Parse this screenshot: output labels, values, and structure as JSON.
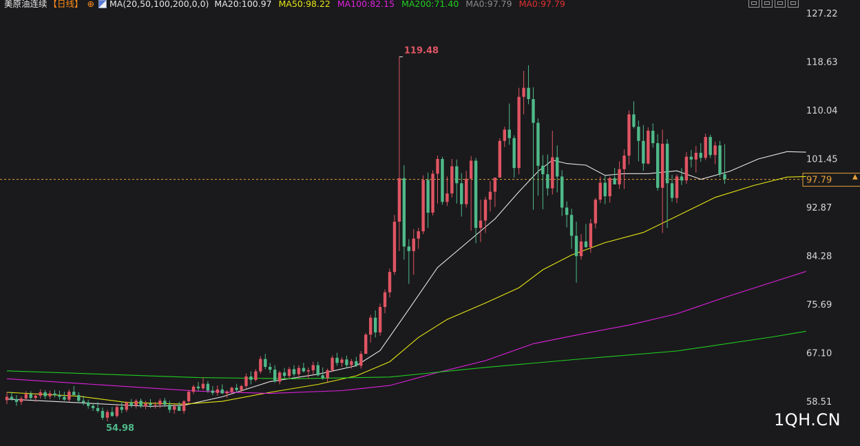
{
  "header": {
    "instrument": "美原油连续",
    "period": "【日线】",
    "settings_glyph": "⊕",
    "indicator_params": "MA(20,50,100,200,0,0)",
    "ma_values": [
      {
        "label": "MA20:100.97",
        "color": "#e8e8e8"
      },
      {
        "label": "MA50:98.22",
        "color": "#e6e614"
      },
      {
        "label": "MA100:82.15",
        "color": "#e020e0"
      },
      {
        "label": "MA200:71.40",
        "color": "#20d020"
      },
      {
        "label": "MA0:97.79",
        "color": "#8a8a8a"
      },
      {
        "label": "MA0:97.79",
        "color": "#e03030"
      }
    ]
  },
  "toolbar": {
    "icons": [
      "expand-icon",
      "window-icon",
      "layout-icon",
      "settings-panel-icon"
    ]
  },
  "watermark": "1QH.CN",
  "colors": {
    "up": "#e05563",
    "down": "#4fb98a",
    "grid": "#3a3a3a",
    "current_line": "#e8a23a",
    "background": "#1a1a1c"
  },
  "chart_data": {
    "type": "candlestick",
    "title": "美原油连续【日线】",
    "y_axis_ticks": [
      "127.22",
      "118.63",
      "110.04",
      "101.45",
      "92.87",
      "84.28",
      "75.69",
      "67.10",
      "58.51"
    ],
    "ylim": [
      53.5,
      128.5
    ],
    "current_price_label": "97.79",
    "current_price": 97.79,
    "annotations": {
      "max_label": "119.48",
      "max_value": 119.48,
      "max_index": 82,
      "min_label": "54.98",
      "min_value": 54.98,
      "min_index": 21
    },
    "ohlc": [
      [
        58.7,
        60.1,
        58.0,
        59.3
      ],
      [
        59.3,
        60.2,
        58.6,
        58.9
      ],
      [
        58.9,
        59.6,
        57.7,
        58.4
      ],
      [
        58.4,
        59.4,
        57.9,
        59.0
      ],
      [
        59.0,
        60.3,
        58.6,
        59.8
      ],
      [
        59.8,
        60.3,
        58.8,
        59.1
      ],
      [
        59.1,
        59.9,
        58.4,
        59.5
      ],
      [
        59.5,
        60.6,
        59.0,
        60.1
      ],
      [
        60.1,
        60.5,
        58.9,
        59.4
      ],
      [
        59.4,
        60.4,
        58.9,
        59.9
      ],
      [
        59.9,
        60.5,
        59.2,
        59.6
      ],
      [
        59.6,
        60.4,
        58.8,
        59.3
      ],
      [
        59.3,
        60.2,
        58.6,
        58.8
      ],
      [
        58.8,
        60.6,
        58.4,
        60.2
      ],
      [
        60.2,
        61.2,
        59.8,
        59.6
      ],
      [
        59.6,
        60.1,
        58.2,
        58.6
      ],
      [
        58.6,
        59.5,
        57.8,
        58.3
      ],
      [
        58.3,
        58.8,
        57.2,
        57.7
      ],
      [
        57.7,
        58.1,
        56.8,
        57.3
      ],
      [
        57.3,
        58.4,
        56.5,
        56.8
      ],
      [
        56.8,
        57.4,
        55.2,
        55.6
      ],
      [
        55.6,
        57.0,
        54.98,
        56.6
      ],
      [
        56.6,
        57.5,
        55.8,
        55.9
      ],
      [
        55.9,
        57.9,
        55.6,
        57.5
      ],
      [
        57.5,
        58.5,
        56.4,
        57.0
      ],
      [
        57.0,
        58.5,
        56.6,
        58.3
      ],
      [
        58.3,
        58.9,
        57.4,
        57.8
      ],
      [
        57.8,
        58.9,
        57.2,
        58.6
      ],
      [
        58.6,
        59.0,
        57.3,
        57.6
      ],
      [
        57.6,
        58.6,
        57.1,
        58.1
      ],
      [
        58.1,
        58.9,
        57.3,
        57.8
      ],
      [
        57.8,
        58.4,
        57.2,
        57.9
      ],
      [
        57.9,
        59.0,
        57.3,
        58.6
      ],
      [
        58.6,
        59.1,
        57.5,
        57.9
      ],
      [
        57.9,
        58.6,
        56.5,
        57.0
      ],
      [
        57.0,
        58.0,
        56.3,
        57.6
      ],
      [
        57.6,
        58.4,
        56.8,
        56.8
      ],
      [
        56.8,
        58.7,
        56.3,
        58.5
      ],
      [
        58.5,
        60.5,
        58.1,
        60.2
      ],
      [
        60.2,
        61.4,
        59.8,
        61.1
      ],
      [
        61.1,
        61.9,
        60.3,
        60.8
      ],
      [
        60.8,
        62.7,
        60.5,
        61.6
      ],
      [
        61.6,
        62.1,
        60.0,
        60.4
      ],
      [
        60.4,
        61.2,
        59.6,
        60.0
      ],
      [
        60.0,
        61.3,
        59.5,
        60.6
      ],
      [
        60.6,
        61.5,
        59.8,
        59.9
      ],
      [
        59.9,
        60.5,
        59.1,
        60.2
      ],
      [
        60.2,
        61.1,
        59.7,
        60.9
      ],
      [
        60.9,
        61.6,
        60.1,
        60.5
      ],
      [
        60.5,
        61.4,
        60.0,
        61.2
      ],
      [
        61.2,
        63.4,
        60.8,
        62.9
      ],
      [
        62.9,
        63.8,
        61.5,
        62.3
      ],
      [
        62.3,
        64.2,
        62.0,
        63.8
      ],
      [
        63.8,
        66.5,
        63.4,
        66.0
      ],
      [
        66.0,
        66.9,
        64.2,
        64.6
      ],
      [
        64.6,
        65.3,
        63.5,
        64.1
      ],
      [
        64.1,
        64.9,
        61.8,
        62.0
      ],
      [
        62.0,
        63.9,
        61.5,
        63.6
      ],
      [
        63.6,
        64.4,
        62.6,
        63.0
      ],
      [
        63.0,
        64.6,
        62.5,
        64.2
      ],
      [
        64.2,
        64.9,
        62.9,
        63.3
      ],
      [
        63.3,
        64.9,
        62.6,
        64.4
      ],
      [
        64.4,
        65.3,
        63.6,
        63.8
      ],
      [
        63.8,
        64.5,
        62.5,
        64.0
      ],
      [
        64.0,
        65.5,
        63.3,
        64.9
      ],
      [
        64.9,
        65.5,
        62.9,
        63.1
      ],
      [
        63.1,
        64.5,
        62.3,
        62.6
      ],
      [
        62.6,
        64.3,
        61.9,
        64.0
      ],
      [
        64.0,
        66.6,
        63.7,
        66.2
      ],
      [
        66.2,
        67.1,
        64.8,
        65.3
      ],
      [
        65.3,
        66.3,
        64.6,
        65.9
      ],
      [
        65.9,
        66.6,
        64.4,
        64.9
      ],
      [
        64.9,
        66.0,
        64.3,
        65.6
      ],
      [
        65.6,
        66.4,
        64.6,
        64.8
      ],
      [
        64.8,
        67.4,
        64.3,
        66.9
      ],
      [
        66.9,
        70.6,
        68.5,
        70.3
      ],
      [
        70.3,
        73.8,
        68.9,
        73.3
      ],
      [
        73.3,
        74.6,
        69.8,
        70.7
      ],
      [
        70.7,
        75.8,
        70.1,
        75.2
      ],
      [
        75.2,
        78.3,
        74.1,
        77.8
      ],
      [
        77.8,
        82.0,
        76.9,
        81.4
      ],
      [
        81.4,
        91.5,
        80.9,
        90.3
      ],
      [
        90.3,
        119.48,
        85.1,
        98.0
      ],
      [
        98.0,
        100.3,
        83.6,
        85.9
      ],
      [
        85.9,
        87.2,
        79.3,
        85.1
      ],
      [
        85.1,
        89.0,
        80.9,
        87.3
      ],
      [
        87.3,
        89.2,
        85.5,
        88.6
      ],
      [
        88.6,
        98.5,
        88.1,
        97.7
      ],
      [
        97.7,
        99.0,
        89.2,
        91.9
      ],
      [
        91.9,
        99.4,
        91.4,
        98.8
      ],
      [
        98.8,
        102.0,
        93.5,
        101.4
      ],
      [
        101.4,
        101.8,
        93.3,
        93.8
      ],
      [
        93.8,
        98.3,
        93.1,
        95.3
      ],
      [
        95.3,
        101.4,
        94.6,
        100.1
      ],
      [
        100.1,
        101.3,
        93.5,
        97.1
      ],
      [
        97.1,
        98.9,
        91.2,
        93.4
      ],
      [
        93.4,
        99.3,
        92.8,
        97.9
      ],
      [
        97.9,
        101.9,
        88.7,
        101.1
      ],
      [
        101.1,
        101.6,
        86.5,
        89.2
      ],
      [
        89.2,
        94.2,
        86.7,
        90.5
      ],
      [
        90.5,
        94.7,
        88.3,
        94.2
      ],
      [
        94.2,
        97.5,
        92.1,
        95.6
      ],
      [
        95.6,
        97.9,
        92.9,
        98.1
      ],
      [
        98.1,
        105.1,
        98.3,
        104.6
      ],
      [
        104.6,
        107.1,
        103.5,
        106.6
      ],
      [
        106.6,
        111.2,
        103.9,
        105.1
      ],
      [
        105.1,
        105.6,
        98.1,
        99.8
      ],
      [
        99.8,
        114.0,
        98.7,
        112.4
      ],
      [
        112.4,
        117.0,
        109.3,
        114.0
      ],
      [
        114.0,
        118.0,
        111.1,
        112.0
      ],
      [
        112.0,
        114.1,
        92.4,
        107.8
      ],
      [
        107.8,
        108.6,
        94.9,
        100.2
      ],
      [
        100.2,
        102.1,
        92.5,
        98.7
      ],
      [
        98.7,
        102.2,
        94.9,
        96.2
      ],
      [
        96.2,
        106.4,
        95.1,
        101.7
      ],
      [
        101.7,
        103.8,
        95.5,
        98.3
      ],
      [
        98.3,
        99.4,
        91.3,
        92.8
      ],
      [
        92.8,
        93.9,
        89.3,
        91.5
      ],
      [
        91.5,
        92.6,
        85.5,
        87.8
      ],
      [
        87.8,
        90.3,
        79.5,
        84.2
      ],
      [
        84.2,
        88.1,
        83.6,
        86.8
      ],
      [
        86.8,
        89.9,
        85.6,
        85.8
      ],
      [
        85.8,
        90.8,
        84.8,
        90.0
      ],
      [
        90.0,
        94.5,
        89.1,
        94.2
      ],
      [
        94.2,
        98.3,
        93.6,
        97.2
      ],
      [
        97.2,
        98.4,
        93.4,
        94.8
      ],
      [
        94.8,
        98.3,
        93.7,
        98.0
      ],
      [
        98.0,
        99.8,
        96.9,
        96.9
      ],
      [
        96.9,
        101.0,
        96.1,
        99.6
      ],
      [
        99.6,
        103.1,
        96.1,
        102.0
      ],
      [
        102.0,
        110.0,
        100.4,
        109.3
      ],
      [
        109.3,
        111.6,
        106.8,
        107.1
      ],
      [
        107.1,
        108.2,
        101.0,
        104.6
      ],
      [
        104.6,
        107.4,
        99.3,
        100.6
      ],
      [
        100.6,
        107.0,
        100.4,
        106.4
      ],
      [
        106.4,
        107.7,
        103.4,
        104.2
      ],
      [
        104.2,
        105.8,
        95.8,
        96.3
      ],
      [
        96.3,
        106.6,
        88.3,
        104.1
      ],
      [
        104.1,
        104.9,
        89.2,
        97.1
      ],
      [
        97.1,
        98.6,
        93.8,
        94.5
      ],
      [
        94.5,
        98.7,
        93.6,
        98.3
      ],
      [
        98.3,
        99.8,
        96.8,
        97.6
      ],
      [
        97.6,
        102.6,
        97.0,
        101.8
      ],
      [
        101.8,
        103.0,
        99.9,
        101.3
      ],
      [
        101.3,
        103.7,
        99.0,
        102.5
      ],
      [
        102.5,
        104.2,
        100.9,
        101.6
      ],
      [
        101.6,
        105.9,
        101.2,
        105.3
      ],
      [
        105.3,
        105.7,
        101.6,
        102.1
      ],
      [
        102.1,
        104.5,
        100.5,
        103.8
      ],
      [
        103.8,
        104.6,
        98.2,
        98.7
      ],
      [
        98.7,
        104.0,
        97.0,
        97.8
      ]
    ],
    "ma_lines": [
      {
        "name": "MA20",
        "color": "#e8e8e8",
        "points": [
          [
            0,
            58.9
          ],
          [
            30,
            57.6
          ],
          [
            37,
            57.8
          ],
          [
            45,
            59.3
          ],
          [
            55,
            62.0
          ],
          [
            65,
            63.3
          ],
          [
            73,
            64.8
          ],
          [
            78,
            67.5
          ],
          [
            84,
            74.8
          ],
          [
            90,
            82.2
          ],
          [
            97,
            87.2
          ],
          [
            102,
            90.8
          ],
          [
            107,
            95.6
          ],
          [
            111,
            99.2
          ],
          [
            114,
            101.2
          ],
          [
            117,
            100.6
          ],
          [
            121,
            100.3
          ],
          [
            125,
            98.5
          ],
          [
            129,
            98.8
          ],
          [
            134,
            98.8
          ],
          [
            140,
            99.3
          ],
          [
            145,
            97.8
          ],
          [
            151,
            99.2
          ],
          [
            157,
            101.4
          ],
          [
            163,
            102.7
          ],
          [
            167,
            102.6
          ]
        ]
      },
      {
        "name": "MA50",
        "color": "#e6e614",
        "points": [
          [
            0,
            60.1
          ],
          [
            15,
            59.4
          ],
          [
            25,
            58.3
          ],
          [
            37,
            58.0
          ],
          [
            45,
            58.5
          ],
          [
            55,
            60.1
          ],
          [
            65,
            61.5
          ],
          [
            73,
            63.0
          ],
          [
            80,
            65.5
          ],
          [
            86,
            69.8
          ],
          [
            92,
            73.0
          ],
          [
            100,
            75.9
          ],
          [
            107,
            78.6
          ],
          [
            112,
            81.8
          ],
          [
            118,
            84.4
          ],
          [
            125,
            86.6
          ],
          [
            133,
            88.4
          ],
          [
            141,
            91.7
          ],
          [
            148,
            94.6
          ],
          [
            156,
            96.7
          ],
          [
            163,
            98.2
          ],
          [
            167,
            98.3
          ]
        ]
      },
      {
        "name": "MA100",
        "color": "#e020e0",
        "points": [
          [
            0,
            62.5
          ],
          [
            20,
            61.4
          ],
          [
            40,
            60.3
          ],
          [
            55,
            59.9
          ],
          [
            70,
            60.4
          ],
          [
            80,
            61.3
          ],
          [
            90,
            63.6
          ],
          [
            100,
            65.7
          ],
          [
            110,
            68.7
          ],
          [
            120,
            70.4
          ],
          [
            130,
            72.0
          ],
          [
            140,
            74.0
          ],
          [
            150,
            76.9
          ],
          [
            160,
            79.6
          ],
          [
            167,
            81.5
          ]
        ]
      },
      {
        "name": "MA200",
        "color": "#20d020",
        "points": [
          [
            0,
            63.9
          ],
          [
            20,
            63.3
          ],
          [
            40,
            62.7
          ],
          [
            60,
            62.5
          ],
          [
            80,
            62.8
          ],
          [
            100,
            64.5
          ],
          [
            120,
            66.0
          ],
          [
            140,
            67.4
          ],
          [
            160,
            69.9
          ],
          [
            167,
            70.9
          ]
        ]
      }
    ]
  }
}
